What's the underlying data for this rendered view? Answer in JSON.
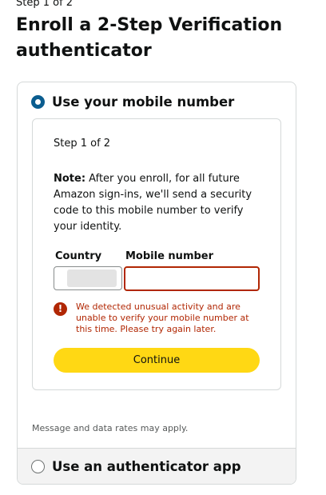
{
  "header": {
    "step_indicator": "Step 1 of 2",
    "title": "Enroll a 2-Step Verification authenticator"
  },
  "options": {
    "mobile": {
      "label": "Use your mobile number",
      "selected": true
    },
    "app": {
      "label": "Use an authenticator app",
      "selected": false
    }
  },
  "form": {
    "step": "Step 1 of 2",
    "note_label": "Note:",
    "note_text": " After you enroll, for all future Amazon sign-ins, we'll send a security code to this mobile number to verify your identity.",
    "country_label": "Country",
    "country_value": "",
    "mobile_label": "Mobile number",
    "mobile_value": "",
    "error_icon": "!",
    "error_message": "We detected unusual activity and are unable to verify your mobile number at this time. Please try again later.",
    "continue_label": "Continue"
  },
  "footer": {
    "disclaimer": "Message and data rates may apply."
  },
  "colors": {
    "accent_button": "#ffd814",
    "error": "#b12704",
    "radio_selected": "#0b5d8f"
  },
  "icons": {
    "radio_selected": "radio-selected-icon",
    "radio_unselected": "radio-unselected-icon",
    "error": "error-alert-icon"
  }
}
